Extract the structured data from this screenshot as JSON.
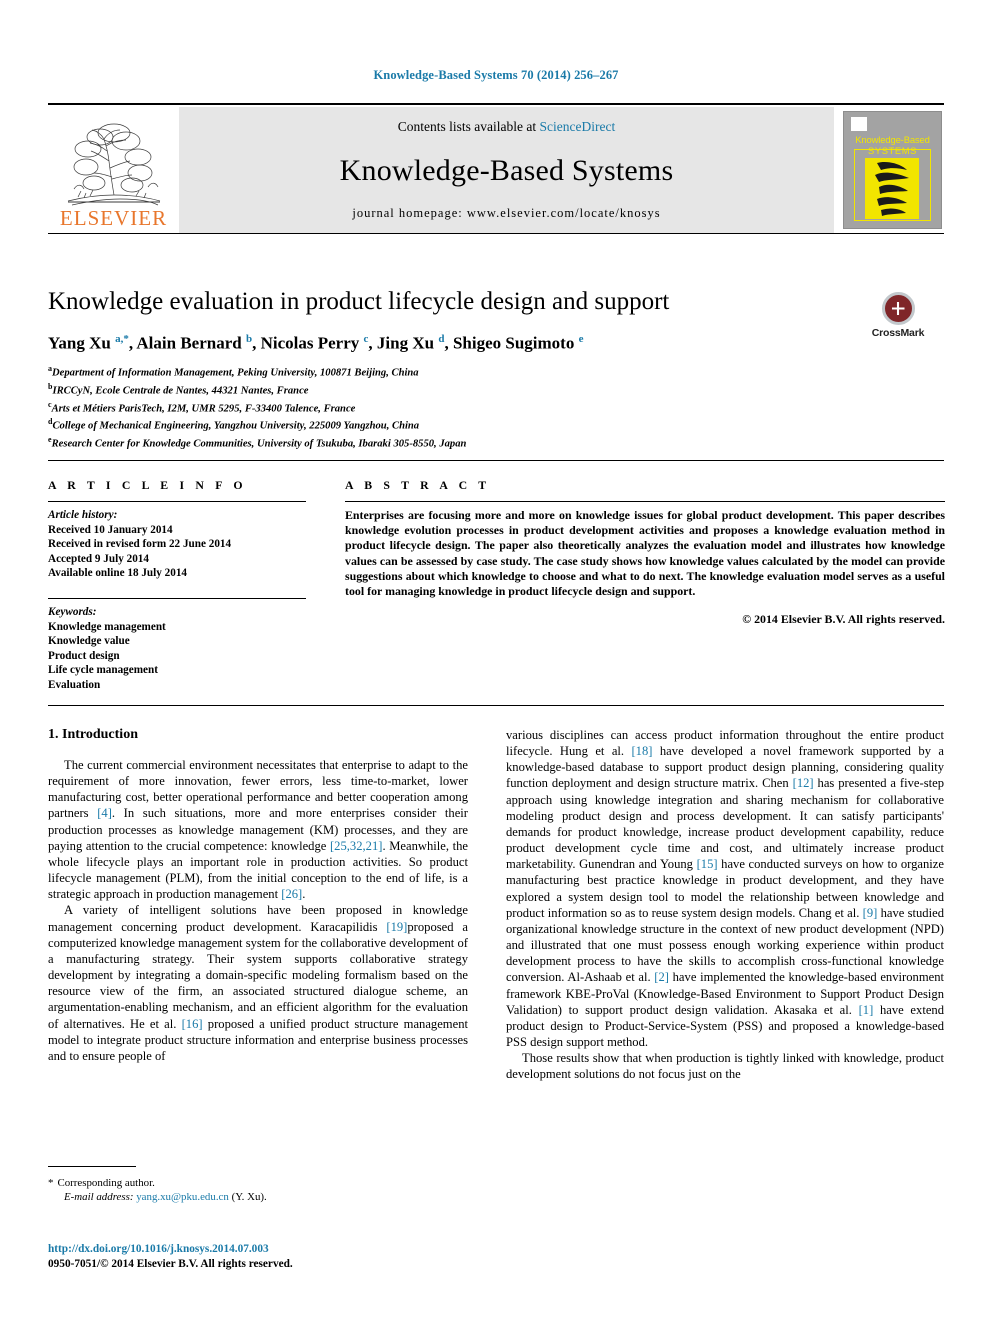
{
  "running_head": "Knowledge-Based Systems 70 (2014) 256–267",
  "masthead": {
    "publisher_name": "ELSEVIER",
    "contents_line_prefix": "Contents lists available at ",
    "contents_link": "ScienceDirect",
    "journal_title": "Knowledge-Based Systems",
    "homepage_line": "journal homepage: www.elsevier.com/locate/knosys",
    "cover": {
      "line1": "Knowledge-Based",
      "line2": "SYSTEMS"
    }
  },
  "article": {
    "title": "Knowledge evaluation in product lifecycle design and support",
    "authors_html": "Yang Xu <sup>a,*</sup>, Alain Bernard <sup>b</sup>, Nicolas Perry <sup>c</sup>, Jing Xu <sup>d</sup>, Shigeo Sugimoto <sup>e</sup>",
    "affiliations": [
      {
        "marker": "a",
        "text": "Department of Information Management, Peking University, 100871 Beijing, China"
      },
      {
        "marker": "b",
        "text": "IRCCyN, Ecole Centrale de Nantes, 44321 Nantes, France"
      },
      {
        "marker": "c",
        "text": "Arts et Métiers ParisTech, I2M, UMR 5295, F-33400 Talence, France"
      },
      {
        "marker": "d",
        "text": "College of Mechanical Engineering, Yangzhou University, 225009 Yangzhou, China"
      },
      {
        "marker": "e",
        "text": "Research Center for Knowledge Communities, University of Tsukuba, Ibaraki 305-8550, Japan"
      }
    ],
    "crossmark_label": "CrossMark"
  },
  "article_info": {
    "heading": "A R T I C L E  I N F O",
    "history_label": "Article history:",
    "history": [
      "Received 10 January 2014",
      "Received in revised form 22 June 2014",
      "Accepted 9 July 2014",
      "Available online 18 July 2014"
    ],
    "keywords_label": "Keywords:",
    "keywords": [
      "Knowledge management",
      "Knowledge value",
      "Product design",
      "Life cycle management",
      "Evaluation"
    ]
  },
  "abstract": {
    "heading": "A B S T R A C T",
    "text": "Enterprises are focusing more and more on knowledge issues for global product development. This paper describes knowledge evolution processes in product development activities and proposes a knowledge evaluation method in product lifecycle design. The paper also theoretically analyzes the evaluation model and illustrates how knowledge values can be assessed by case study. The case study shows how knowledge values calculated by the model can provide suggestions about which knowledge to choose and what to do next. The knowledge evaluation model serves as a useful tool for managing knowledge in product lifecycle design and support.",
    "copyright": "© 2014 Elsevier B.V. All rights reserved."
  },
  "body": {
    "section_heading": "1. Introduction",
    "left_paragraphs": [
      {
        "indent": true,
        "parts": [
          {
            "t": "The current commercial environment necessitates that enterprise to adapt to the requirement of more innovation, fewer errors, less time-to-market, lower manufacturing cost, better operational performance and better cooperation among partners "
          },
          {
            "t": "[4]",
            "ref": true
          },
          {
            "t": ". In such situations, more and more enterprises consider their production processes as knowledge management (KM) processes, and they are paying attention to the crucial competence: knowledge "
          },
          {
            "t": "[25,32,21]",
            "ref": true
          },
          {
            "t": ". Meanwhile, the whole lifecycle plays an important role in production activities. So product lifecycle management (PLM), from the initial conception to the end of life, is a strategic approach in production management "
          },
          {
            "t": "[26]",
            "ref": true
          },
          {
            "t": "."
          }
        ]
      },
      {
        "indent": true,
        "parts": [
          {
            "t": "A variety of intelligent solutions have been proposed in knowledge management concerning product development. Karacapilidis "
          },
          {
            "t": "[19]",
            "ref": true
          },
          {
            "t": "proposed a computerized knowledge management system for the collaborative development of a manufacturing strategy. Their system supports collaborative strategy development by integrating a domain-specific modeling formalism based on the resource view of the firm, an associated structured dialogue scheme, an argumentation-enabling mechanism, and an efficient algorithm for the evaluation of alternatives. He et al. "
          },
          {
            "t": "[16]",
            "ref": true
          },
          {
            "t": " proposed a unified product structure management model to integrate product structure information and enterprise business processes and to ensure people of"
          }
        ]
      }
    ],
    "right_paragraphs": [
      {
        "indent": false,
        "parts": [
          {
            "t": "various disciplines can access product information throughout the entire product lifecycle. Hung et al. "
          },
          {
            "t": "[18]",
            "ref": true
          },
          {
            "t": " have developed a novel framework supported by a knowledge-based database to support product design planning, considering quality function deployment and design structure matrix. Chen "
          },
          {
            "t": "[12]",
            "ref": true
          },
          {
            "t": " has presented a five-step approach using knowledge integration and sharing mechanism for collaborative modeling product design and process development. It can satisfy participants' demands for product knowledge, increase product development capability, reduce product development cycle time and cost, and ultimately increase product marketability. Gunendran and Young "
          },
          {
            "t": "[15]",
            "ref": true
          },
          {
            "t": " have conducted surveys on how to organize manufacturing best practice knowledge in product development, and they have explored a system design tool to model the relationship between knowledge and product information so as to reuse system design models. Chang et al. "
          },
          {
            "t": "[9]",
            "ref": true
          },
          {
            "t": " have studied organizational knowledge structure in the context of new product development (NPD) and illustrated that one must possess enough working experience within product development process to have the skills to accomplish cross-functional knowledge conversion. Al-Ashaab et al. "
          },
          {
            "t": "[2]",
            "ref": true
          },
          {
            "t": " have implemented the knowledge-based environment framework KBE-ProVal (Knowledge-Based Environment to Support Product Design Validation) to support product design validation. Akasaka et al. "
          },
          {
            "t": "[1]",
            "ref": true
          },
          {
            "t": " have extend product design to Product-Service-System (PSS) and proposed a knowledge-based PSS design support method."
          }
        ]
      },
      {
        "indent": true,
        "parts": [
          {
            "t": "Those results show that when production is tightly linked with knowledge, product development solutions do not focus just on the"
          }
        ]
      }
    ]
  },
  "footnote": {
    "star": "*",
    "corresponding": "Corresponding author.",
    "email_label": "E-mail address:",
    "email": "yang.xu@pku.edu.cn",
    "email_suffix": "(Y. Xu)."
  },
  "publisher_footer": {
    "doi": "http://dx.doi.org/10.1016/j.knosys.2014.07.003",
    "issn_line": "0950-7051/© 2014 Elsevier B.V. All rights reserved."
  },
  "colors": {
    "link": "#1a7aa8",
    "elsevier_orange": "#E8762C",
    "masthead_bg": "#e6e6e6",
    "cover_gray": "#a3a3a3",
    "cover_yellow": "#f2e500",
    "crossmark_red": "#7f2629"
  }
}
